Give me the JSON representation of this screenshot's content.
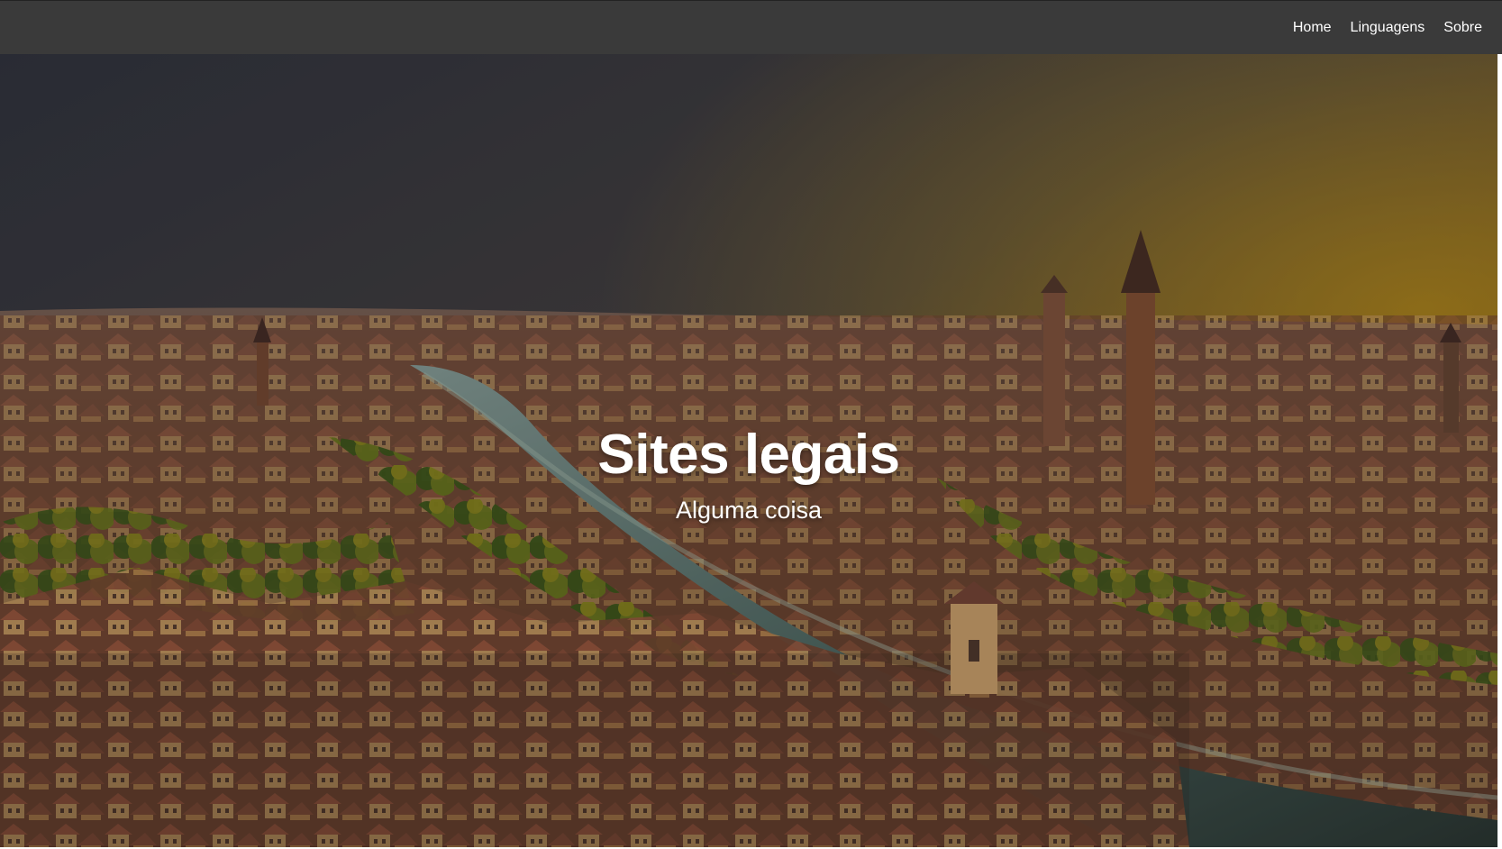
{
  "navbar": {
    "items": [
      {
        "label": "Home"
      },
      {
        "label": "Linguagens"
      },
      {
        "label": "Sobre"
      }
    ]
  },
  "hero": {
    "title": "Sites legais",
    "subtitle": "Alguma coisa"
  }
}
